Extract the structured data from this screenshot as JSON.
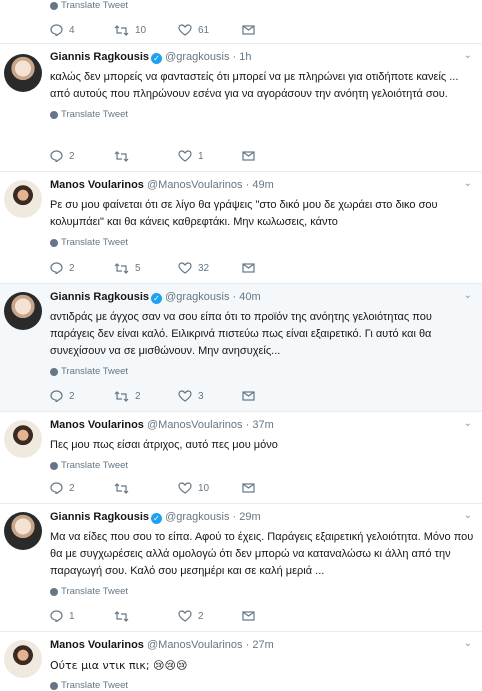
{
  "top_fragment": {
    "translate": "Translate Tweet",
    "reply_count": "4",
    "retweet_count": "10",
    "like_count": "61"
  },
  "tweets": [
    {
      "name": "Giannis Ragkousis",
      "verified": true,
      "handle": "@gragkousis",
      "time": "1h",
      "text": "καλώς δεν μπορείς να φανταστείς ότι μπορεί να με πληρώνει για οτιδήποτε κανείς ... από αυτούς που πληρώνουν εσένα για να αγοράσουν την ανόητη γελοιότητά σου.",
      "translate": "Translate Tweet",
      "reply_count": "2",
      "retweet_count": "",
      "like_count": "1"
    },
    {
      "name": "Manos Voularinos",
      "verified": false,
      "handle": "@ManosVoularinos",
      "time": "49m",
      "text": "Ρε συ μου φαίνεται ότι σε λίγο θα γράψεις \"στο δικό μου δε χωράει στο δικο σου κολυμπάει\" και θα κάνεις καθρεφτάκι. Μην κωλωσεις, κάντο",
      "translate": "Translate Tweet",
      "reply_count": "2",
      "retweet_count": "5",
      "like_count": "32"
    },
    {
      "name": "Giannis Ragkousis",
      "verified": true,
      "handle": "@gragkousis",
      "time": "40m",
      "text": "αντιδράς με άγχος σαν να σου είπα ότι το προϊόν της ανόητης γελοιότητας που παράγεις δεν είναι καλό. Ειλικρινά πιστεύω πως είναι εξαιρετικό. Γι αυτό και θα συνεχίσουν να σε μισθώνουν. Μην ανησυχείς...",
      "translate": "Translate Tweet",
      "reply_count": "2",
      "retweet_count": "2",
      "like_count": "3"
    },
    {
      "name": "Manos Voularinos",
      "verified": false,
      "handle": "@ManosVoularinos",
      "time": "37m",
      "text": "Πες μου πως είσαι άτριχος, αυτό πες μου μόνο",
      "translate": "Translate Tweet",
      "reply_count": "2",
      "retweet_count": "",
      "like_count": "10"
    },
    {
      "name": "Giannis Ragkousis",
      "verified": true,
      "handle": "@gragkousis",
      "time": "29m",
      "text": "Μα να είδες που σου το είπα. Αφού το έχεις. Παράγεις εξαιρετική γελοιότητα. Μόνο που θα με συγχωρέσεις αλλά ομολογώ ότι δεν μπορώ να καταναλώσω κι άλλη από την παραγωγή σου. Καλό σου μεσημέρι και σε καλή μεριά ...",
      "translate": "Translate Tweet",
      "reply_count": "1",
      "retweet_count": "",
      "like_count": "2"
    },
    {
      "name": "Manos Voularinos",
      "verified": false,
      "handle": "@ManosVoularinos",
      "time": "27m",
      "text": "Ούτε μια ντικ πικ; 😢😢😢",
      "translate": "Translate Tweet",
      "reply_count": "",
      "retweet_count": "",
      "like_count": ""
    }
  ],
  "separator": "·",
  "colors": {
    "accent": "#1da1f2",
    "muted": "#657786",
    "highlight_bg": "#f5f8fa"
  }
}
